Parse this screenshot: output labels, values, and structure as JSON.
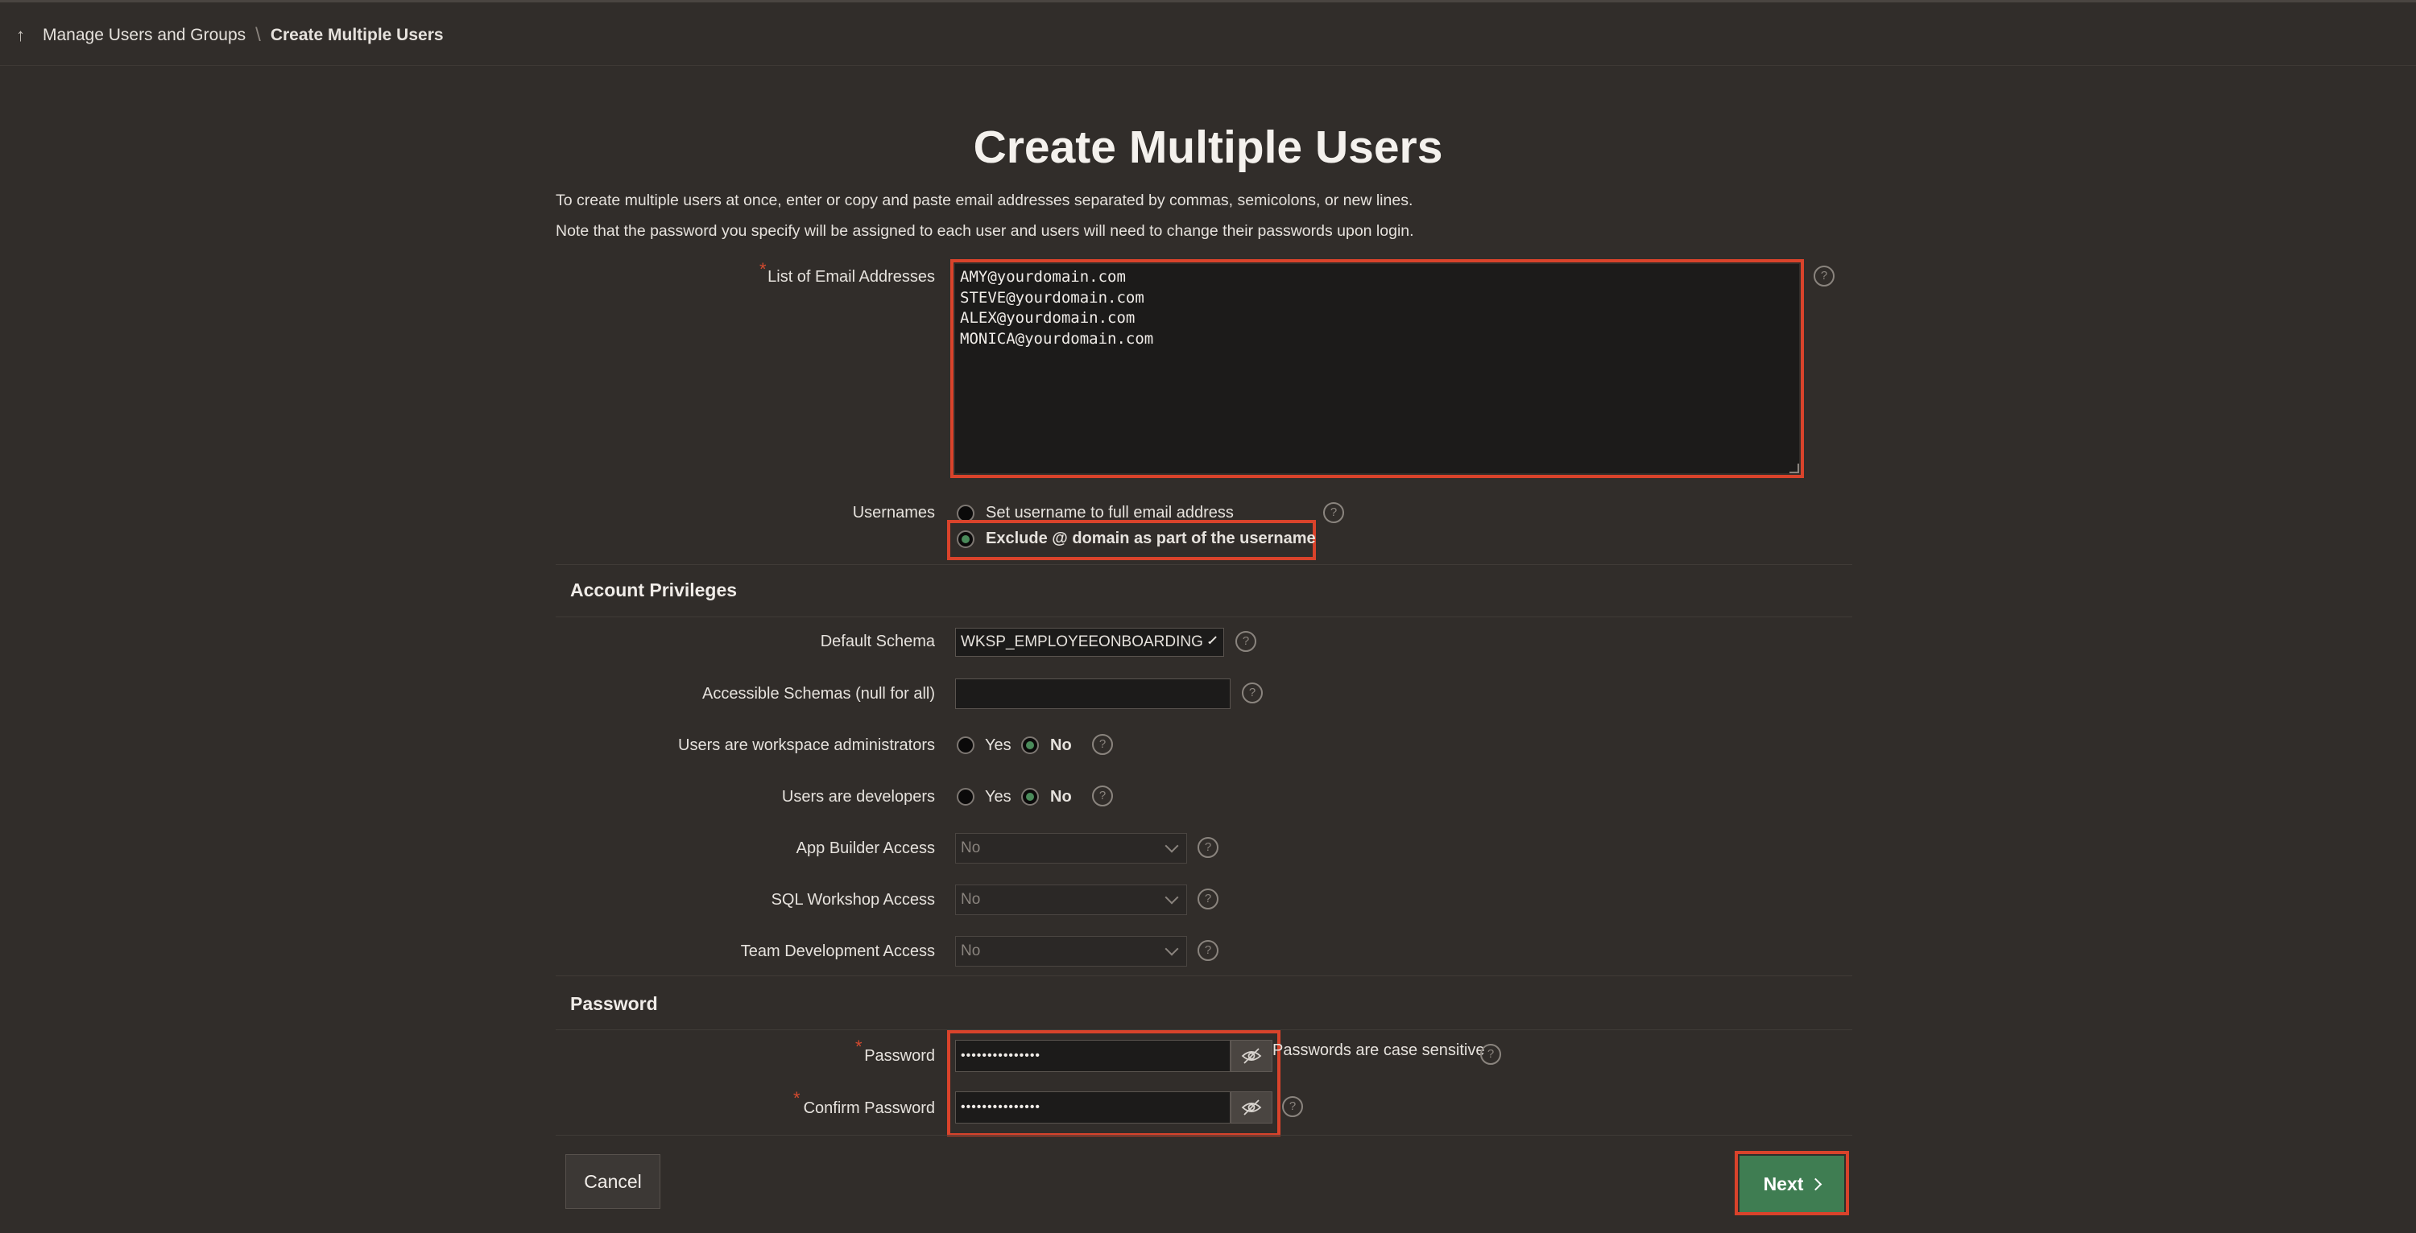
{
  "breadcrumb": {
    "parent": "Manage Users and Groups",
    "separator": "\\",
    "current": "Create Multiple Users"
  },
  "page": {
    "title": "Create Multiple Users",
    "intro_line1": "To create multiple users at once, enter or copy and paste email addresses separated by commas, semicolons, or new lines.",
    "intro_line2": "Note that the password you specify will be assigned to each user and users will need to change their passwords upon login."
  },
  "emails": {
    "label": "List of Email Addresses",
    "value": "AMY@yourdomain.com\nSTEVE@yourdomain.com\nALEX@yourdomain.com\nMONICA@yourdomain.com"
  },
  "usernames": {
    "label": "Usernames",
    "options": [
      {
        "label": "Set username to full email address",
        "selected": false
      },
      {
        "label": "Exclude @ domain as part of the username",
        "selected": true
      }
    ]
  },
  "account_privileges": {
    "title": "Account Privileges",
    "default_schema": {
      "label": "Default Schema",
      "value": "WKSP_EMPLOYEEONBOARDING"
    },
    "accessible_schemas": {
      "label": "Accessible Schemas (null for all)",
      "value": ""
    },
    "workspace_admins": {
      "label": "Users are workspace administrators",
      "yes": "Yes",
      "no": "No",
      "selected": "No"
    },
    "developers": {
      "label": "Users are developers",
      "yes": "Yes",
      "no": "No",
      "selected": "No"
    },
    "app_builder": {
      "label": "App Builder Access",
      "value": "No"
    },
    "sql_workshop": {
      "label": "SQL Workshop Access",
      "value": "No"
    },
    "team_dev": {
      "label": "Team Development Access",
      "value": "No"
    }
  },
  "password": {
    "title": "Password",
    "password_label": "Password",
    "password_value": "•••••••••••••••",
    "confirm_label": "Confirm Password",
    "confirm_value": "•••••••••••••••",
    "note": "Passwords are case sensitive"
  },
  "buttons": {
    "cancel": "Cancel",
    "next": "Next"
  },
  "colors": {
    "background": "#312d2a",
    "highlight": "#d9432b",
    "primary": "#3f7d52",
    "required": "#d34a2f"
  }
}
